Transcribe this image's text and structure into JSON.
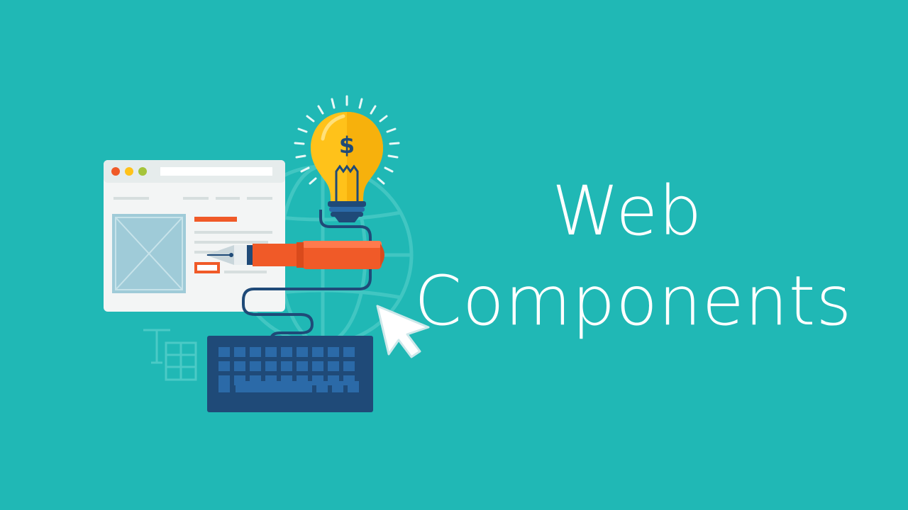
{
  "title": {
    "line1": "Web",
    "line2": "Components"
  },
  "bulb": {
    "symbol": "$"
  },
  "illustration": {
    "elements": [
      "browser-window-icon",
      "lightbulb-icon",
      "pen-icon",
      "globe-icon",
      "keyboard-icon",
      "cursor-arrow-icon",
      "text-tool-icon",
      "grid-icon"
    ]
  },
  "colors": {
    "background": "#20b8b5",
    "browser_body": "#f3f5f5",
    "image_placeholder": "#9fcbd8",
    "accent_orange": "#f05a28",
    "bulb_yellow": "#ffc21a",
    "keyboard_dark": "#1f4a78",
    "keyboard_key": "#2b6aa8",
    "text": "#ffffff"
  }
}
